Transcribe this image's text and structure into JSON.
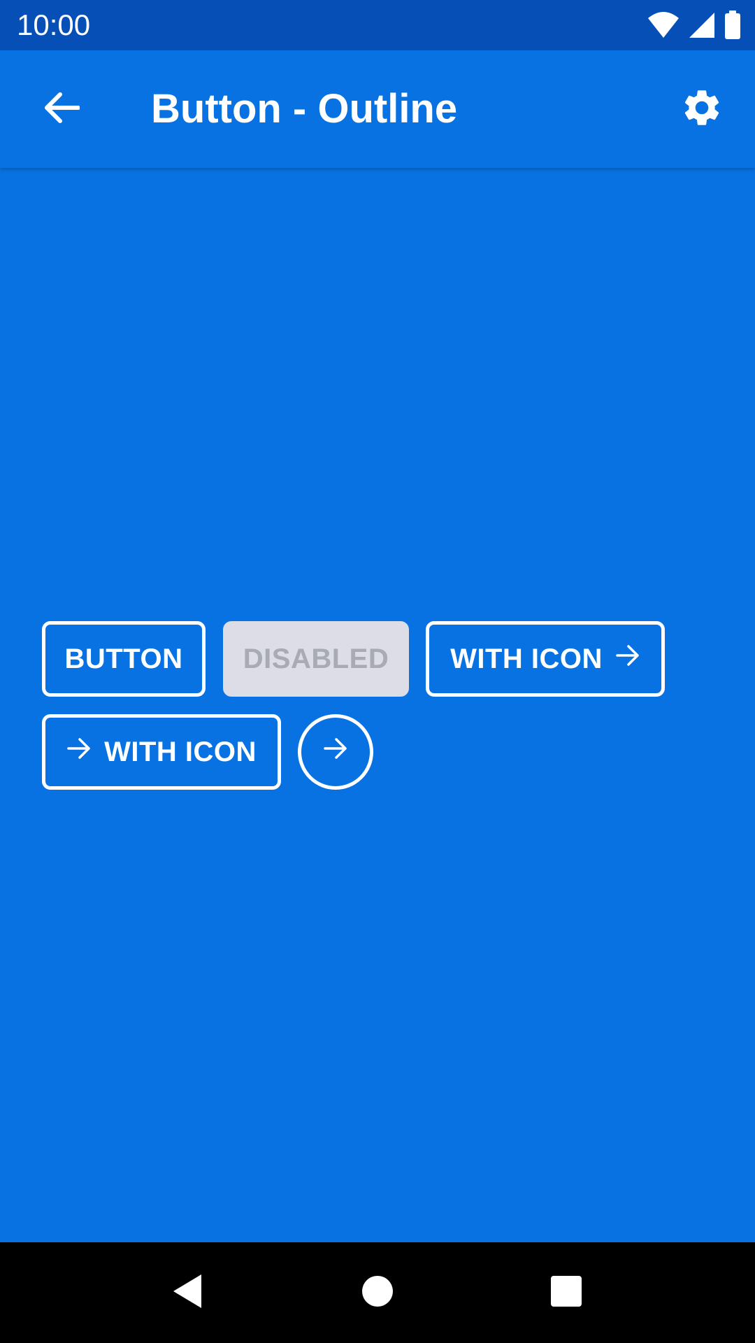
{
  "status_bar": {
    "time": "10:00",
    "icons": [
      "wifi-icon",
      "cell-signal-icon",
      "battery-icon"
    ]
  },
  "app_bar": {
    "title": "Button - Outline",
    "back_icon": "arrow-back-icon",
    "settings_icon": "gear-icon"
  },
  "buttons": {
    "button_label": "BUTTON",
    "disabled_label": "DISABLED",
    "with_icon_right_label": "WITH ICON",
    "with_icon_left_label": "WITH ICON",
    "circle_icon": "arrow-forward-icon"
  },
  "nav_bar": {
    "icons": [
      "nav-back-icon",
      "nav-home-icon",
      "nav-recents-icon"
    ]
  },
  "colors": {
    "background": "#0872E2",
    "status_bar": "#064FB7",
    "outline": "#FFFFFF",
    "disabled_bg": "#DCDDE6",
    "disabled_text": "#A9ABB4",
    "nav_bar": "#000000"
  }
}
